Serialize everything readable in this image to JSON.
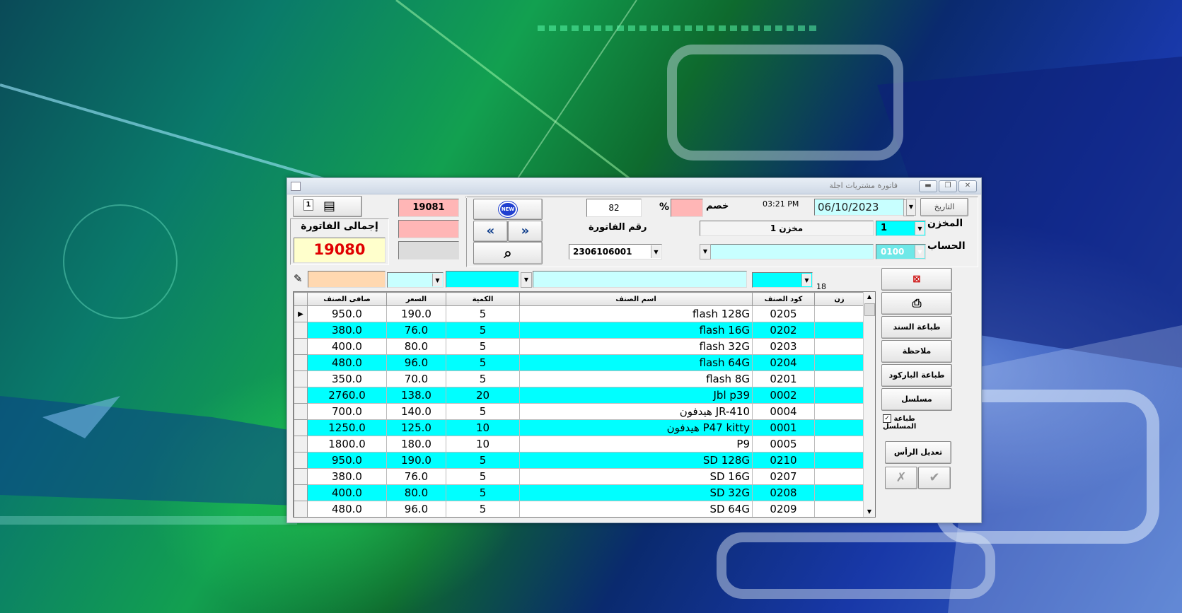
{
  "window": {
    "title": "فاتورة مشتريات اجلة"
  },
  "header": {
    "date_label": "التاريخ",
    "date_value": "06/10/2023",
    "time": "03:21 PM",
    "discount_label": "خصم",
    "percent_sign": "%",
    "discount_value": "",
    "invoice_count": "82",
    "invoice_no_label": "رقم الفاتورة",
    "invoice_no": "2306106001",
    "store_label": "المخزن",
    "store_code": "1",
    "store_name": "مخزن 1",
    "account_label": "الحساب",
    "account_code": "0100",
    "account_name": "",
    "new_badge": "NEW"
  },
  "totals": {
    "label": "إجمالى الفاتورة",
    "value": "19080",
    "box1": "19081",
    "box2": "",
    "box3": "",
    "copies": "1"
  },
  "entry_row": {
    "count": "18"
  },
  "grid": {
    "headers": {
      "z": "زن",
      "code": "كود الصنف",
      "name": "اسم الصنف",
      "qty": "الكمية",
      "price": "السعر",
      "net": "صافى الصنف"
    },
    "rows": [
      {
        "code": "0205",
        "name": "flash 128G",
        "qty": "5",
        "price": "190.0",
        "net": "950.0"
      },
      {
        "code": "0202",
        "name": "flash 16G",
        "qty": "5",
        "price": "76.0",
        "net": "380.0"
      },
      {
        "code": "0203",
        "name": "flash 32G",
        "qty": "5",
        "price": "80.0",
        "net": "400.0"
      },
      {
        "code": "0204",
        "name": "flash 64G",
        "qty": "5",
        "price": "96.0",
        "net": "480.0"
      },
      {
        "code": "0201",
        "name": "flash 8G",
        "qty": "5",
        "price": "70.0",
        "net": "350.0"
      },
      {
        "code": "0002",
        "name": "Jbl p39",
        "qty": "20",
        "price": "138.0",
        "net": "2760.0"
      },
      {
        "code": "0004",
        "name": "هيدفون JR-410",
        "qty": "5",
        "price": "140.0",
        "net": "700.0"
      },
      {
        "code": "0001",
        "name": "هيدفون P47 kitty",
        "qty": "10",
        "price": "125.0",
        "net": "1250.0"
      },
      {
        "code": "0005",
        "name": "P9",
        "qty": "10",
        "price": "180.0",
        "net": "1800.0"
      },
      {
        "code": "0210",
        "name": "SD 128G",
        "qty": "5",
        "price": "190.0",
        "net": "950.0"
      },
      {
        "code": "0207",
        "name": "SD 16G",
        "qty": "5",
        "price": "76.0",
        "net": "380.0"
      },
      {
        "code": "0208",
        "name": "SD 32G",
        "qty": "5",
        "price": "80.0",
        "net": "400.0"
      },
      {
        "code": "0209",
        "name": "SD 64G",
        "qty": "5",
        "price": "96.0",
        "net": "480.0"
      }
    ]
  },
  "side_buttons": {
    "print_doc": "طباعة السند",
    "note": "ملاحظة",
    "print_barcode": "طباعة الباركود",
    "serial": "مسلسل",
    "print_serial": "طباعة المسلسل",
    "edit_header": "تعديل الرأس"
  },
  "colors": {
    "cyan": "#00ffff",
    "light_cyan": "#c8ffff",
    "pink": "#ffb6b6",
    "total_red": "#e00000"
  }
}
